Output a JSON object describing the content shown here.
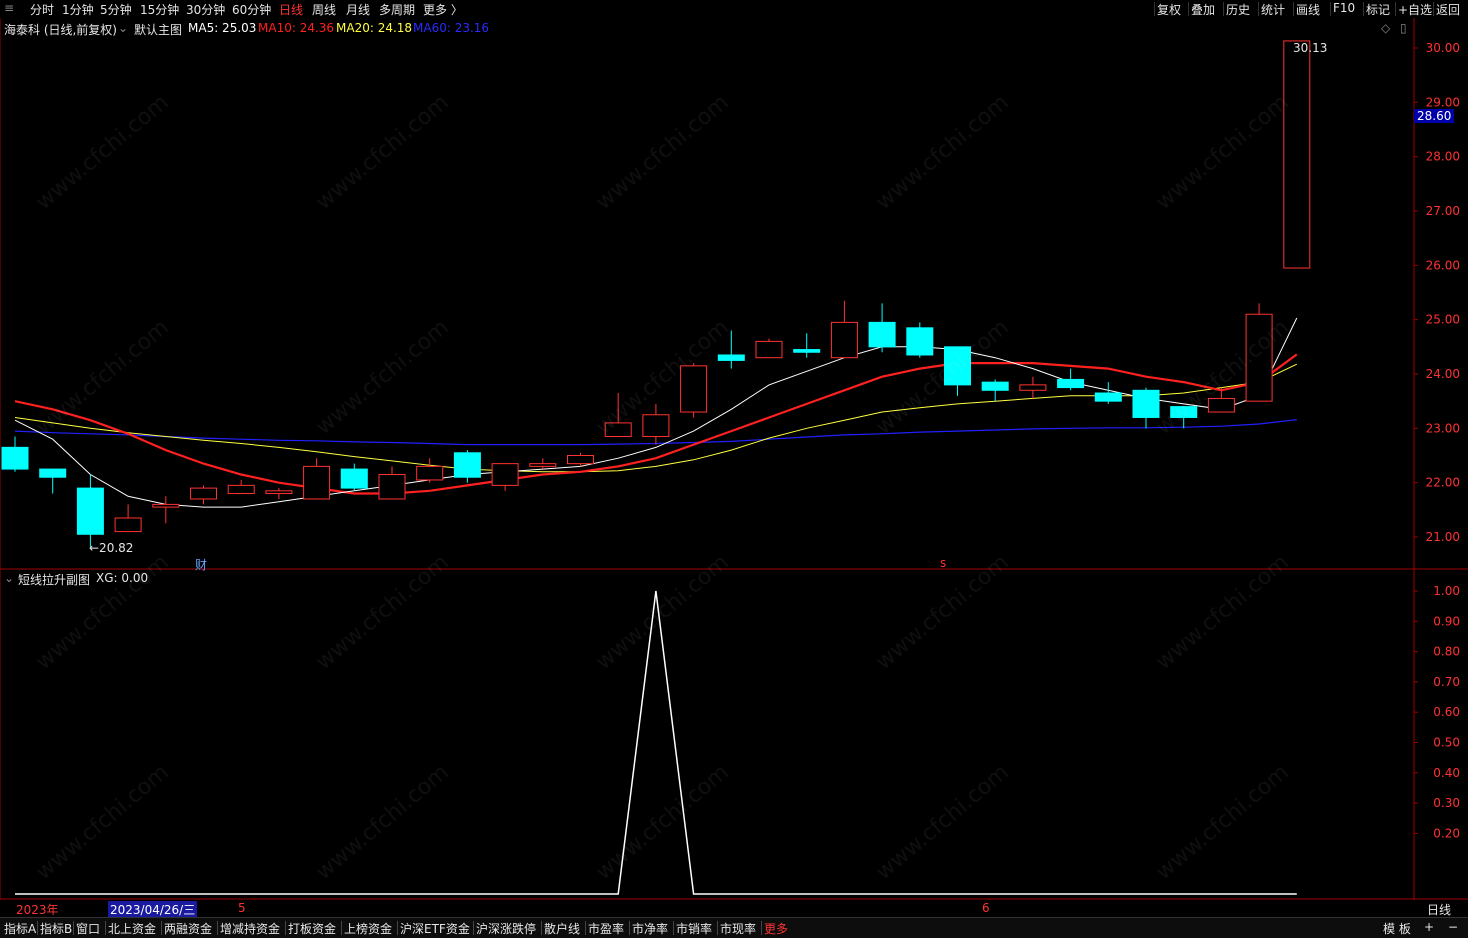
{
  "toolbar": {
    "menu_glyph": "≡",
    "periods": [
      "分时",
      "1分钟",
      "5分钟",
      "15分钟",
      "30分钟",
      "60分钟",
      "日线",
      "周线",
      "月线",
      "多周期",
      "更多 〉"
    ],
    "active_period": "日线",
    "right_items": [
      "复权",
      "叠加",
      "历史",
      "统计",
      "画线",
      "F10",
      "标记",
      "+自选",
      "返回"
    ]
  },
  "main_chart": {
    "stock_title": "海泰科 (日线,前复权)",
    "template_label": "默认主图",
    "ma5_label": "MA5: 25.03",
    "ma10_label": "MA10: 24.36",
    "ma20_label": "MA20: 24.18",
    "ma60_label": "MA60: 23.16",
    "current_price_badge": "28.60",
    "high_marker": "30.13",
    "low_marker": "←20.82",
    "event_marker_cai": "财",
    "event_marker_s": "s",
    "price_ticks": [
      "30.00",
      "29.00",
      "28.00",
      "27.00",
      "26.00",
      "25.00",
      "24.00",
      "23.00",
      "22.00",
      "21.00"
    ]
  },
  "sub_chart": {
    "title": "短线拉升副图",
    "xg_label": "XG: 0.00",
    "ticks": [
      "1.00",
      "0.90",
      "0.80",
      "0.70",
      "0.60",
      "0.50",
      "0.40",
      "0.30",
      "0.20"
    ]
  },
  "time_axis": {
    "year_label": "2023年",
    "cursor_date": "2023/04/26/三",
    "month_5": "5",
    "month_6": "6",
    "period_label": "日线"
  },
  "bottom_tabs": {
    "items": [
      "指标A",
      "指标B",
      "窗口",
      "北上资金",
      "两融资金",
      "增减持资金",
      "打板资金",
      "上榜资金",
      "沪深ETF资金",
      "沪深涨跌停",
      "散户线",
      "市盈率",
      "市净率",
      "市销率",
      "市现率",
      "更多"
    ],
    "right_items": [
      "模 板",
      "+",
      "−"
    ]
  },
  "colors": {
    "up": "#ff3232",
    "down": "#00ffff",
    "ma5": "#ffffff",
    "ma10": "#ff2020",
    "ma20": "#ffff40",
    "ma60": "#2020ff",
    "axis": "#a00000",
    "xg": "#ffffff"
  },
  "watermark": "www.cfchi.com",
  "chart_data": {
    "type": "candlestick",
    "ylim": [
      20.5,
      30.4
    ],
    "candles": [
      {
        "o": 22.65,
        "c": 22.25,
        "h": 22.85,
        "l": 22.2
      },
      {
        "o": 22.25,
        "c": 22.1,
        "h": 22.25,
        "l": 21.8
      },
      {
        "o": 21.9,
        "c": 21.05,
        "h": 22.15,
        "l": 20.82
      },
      {
        "o": 21.1,
        "c": 21.35,
        "h": 21.6,
        "l": 21.1
      },
      {
        "o": 21.55,
        "c": 21.6,
        "h": 21.75,
        "l": 21.25
      },
      {
        "o": 21.7,
        "c": 21.9,
        "h": 21.95,
        "l": 21.6
      },
      {
        "o": 21.8,
        "c": 21.95,
        "h": 22.05,
        "l": 21.8
      },
      {
        "o": 21.8,
        "c": 21.85,
        "h": 21.9,
        "l": 21.7
      },
      {
        "o": 21.7,
        "c": 22.3,
        "h": 22.45,
        "l": 21.7
      },
      {
        "o": 22.25,
        "c": 21.9,
        "h": 22.35,
        "l": 21.85
      },
      {
        "o": 21.7,
        "c": 22.15,
        "h": 22.3,
        "l": 21.7
      },
      {
        "o": 22.05,
        "c": 22.3,
        "h": 22.45,
        "l": 22.0
      },
      {
        "o": 22.55,
        "c": 22.1,
        "h": 22.6,
        "l": 22.0
      },
      {
        "o": 21.95,
        "c": 22.35,
        "h": 22.35,
        "l": 21.85
      },
      {
        "o": 22.3,
        "c": 22.35,
        "h": 22.45,
        "l": 22.25
      },
      {
        "o": 22.35,
        "c": 22.5,
        "h": 22.55,
        "l": 22.3
      },
      {
        "o": 22.85,
        "c": 23.1,
        "h": 23.65,
        "l": 22.85
      },
      {
        "o": 22.85,
        "c": 23.25,
        "h": 23.45,
        "l": 22.7
      },
      {
        "o": 23.3,
        "c": 24.15,
        "h": 24.2,
        "l": 23.2
      },
      {
        "o": 24.35,
        "c": 24.25,
        "h": 24.8,
        "l": 24.1
      },
      {
        "o": 24.3,
        "c": 24.6,
        "h": 24.65,
        "l": 24.3
      },
      {
        "o": 24.45,
        "c": 24.4,
        "h": 24.75,
        "l": 24.3
      },
      {
        "o": 24.3,
        "c": 24.95,
        "h": 25.35,
        "l": 24.3
      },
      {
        "o": 24.95,
        "c": 24.5,
        "h": 25.3,
        "l": 24.4
      },
      {
        "o": 24.85,
        "c": 24.35,
        "h": 24.95,
        "l": 24.3
      },
      {
        "o": 24.5,
        "c": 23.8,
        "h": 24.5,
        "l": 23.6
      },
      {
        "o": 23.85,
        "c": 23.7,
        "h": 23.9,
        "l": 23.5
      },
      {
        "o": 23.7,
        "c": 23.8,
        "h": 23.95,
        "l": 23.55
      },
      {
        "o": 23.9,
        "c": 23.75,
        "h": 24.1,
        "l": 23.7
      },
      {
        "o": 23.65,
        "c": 23.5,
        "h": 23.85,
        "l": 23.45
      },
      {
        "o": 23.7,
        "c": 23.2,
        "h": 23.75,
        "l": 23.0
      },
      {
        "o": 23.4,
        "c": 23.2,
        "h": 23.4,
        "l": 23.0
      },
      {
        "o": 23.3,
        "c": 23.55,
        "h": 23.75,
        "l": 23.3
      },
      {
        "o": 23.5,
        "c": 25.1,
        "h": 25.3,
        "l": 23.5
      },
      {
        "o": 25.95,
        "c": 30.13,
        "h": 30.13,
        "l": 25.95
      }
    ],
    "ma5": [
      23.15,
      22.8,
      22.15,
      21.75,
      21.6,
      21.55,
      21.55,
      21.65,
      21.75,
      21.85,
      21.95,
      22.05,
      22.15,
      22.2,
      22.25,
      22.3,
      22.45,
      22.65,
      22.95,
      23.35,
      23.8,
      24.05,
      24.3,
      24.5,
      24.5,
      24.45,
      24.3,
      24.1,
      23.85,
      23.7,
      23.55,
      23.45,
      23.35,
      23.6,
      25.03
    ],
    "ma10": [
      23.5,
      23.35,
      23.15,
      22.9,
      22.6,
      22.35,
      22.15,
      22.0,
      21.9,
      21.8,
      21.8,
      21.85,
      21.95,
      22.05,
      22.15,
      22.2,
      22.3,
      22.45,
      22.7,
      22.95,
      23.2,
      23.45,
      23.7,
      23.95,
      24.1,
      24.2,
      24.2,
      24.2,
      24.15,
      24.1,
      23.95,
      23.85,
      23.7,
      23.85,
      24.36
    ],
    "ma20": [
      23.2,
      23.1,
      23.0,
      22.92,
      22.85,
      22.78,
      22.72,
      22.65,
      22.57,
      22.48,
      22.4,
      22.32,
      22.25,
      22.22,
      22.2,
      22.2,
      22.22,
      22.3,
      22.42,
      22.6,
      22.82,
      23.0,
      23.15,
      23.3,
      23.38,
      23.45,
      23.5,
      23.55,
      23.6,
      23.6,
      23.6,
      23.65,
      23.75,
      23.85,
      24.18
    ],
    "ma60": [
      22.95,
      22.92,
      22.9,
      22.88,
      22.85,
      22.82,
      22.8,
      22.78,
      22.77,
      22.75,
      22.74,
      22.72,
      22.7,
      22.7,
      22.7,
      22.7,
      22.71,
      22.72,
      22.74,
      22.76,
      22.8,
      22.84,
      22.88,
      22.9,
      22.93,
      22.95,
      22.97,
      22.99,
      23.0,
      23.01,
      23.01,
      23.02,
      23.04,
      23.08,
      23.16
    ],
    "xg": [
      0,
      0,
      0,
      0,
      0,
      0,
      0,
      0,
      0,
      0,
      0,
      0,
      0,
      0,
      0,
      0,
      0,
      1,
      0,
      0,
      0,
      0,
      0,
      0,
      0,
      0,
      0,
      0,
      0,
      0,
      0,
      0,
      0,
      0,
      0
    ]
  }
}
